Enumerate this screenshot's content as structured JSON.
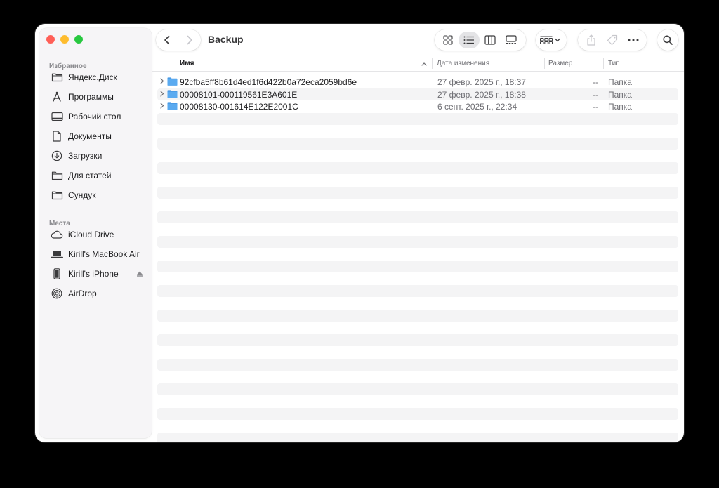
{
  "window": {
    "title": "Backup"
  },
  "sidebar": {
    "favorites_title": "Избранное",
    "favorites": [
      {
        "label": "Яндекс.Диск",
        "icon": "folder-icon"
      },
      {
        "label": "Программы",
        "icon": "applications-icon"
      },
      {
        "label": "Рабочий стол",
        "icon": "desktop-icon"
      },
      {
        "label": "Документы",
        "icon": "document-icon"
      },
      {
        "label": "Загрузки",
        "icon": "downloads-icon"
      },
      {
        "label": "Для статей",
        "icon": "folder-icon"
      },
      {
        "label": "Сундук",
        "icon": "folder-icon"
      }
    ],
    "locations_title": "Места",
    "locations": [
      {
        "label": "iCloud Drive",
        "icon": "cloud-icon"
      },
      {
        "label": "Kirill's MacBook Air",
        "icon": "laptop-icon"
      },
      {
        "label": "Kirill's iPhone",
        "icon": "iphone-icon"
      },
      {
        "label": "AirDrop",
        "icon": "airdrop-icon"
      }
    ]
  },
  "columns": {
    "name": "Имя",
    "date": "Дата изменения",
    "size": "Размер",
    "kind": "Тип"
  },
  "files": [
    {
      "name": "92cfba5ff8b61d4ed1f6d422b0a72eca2059bd6e",
      "date": "27 февр. 2025 г., 18:37",
      "size": "--",
      "kind": "Папка"
    },
    {
      "name": "00008101-000119561E3A601E",
      "date": "27 февр. 2025 г., 18:38",
      "size": "--",
      "kind": "Папка"
    },
    {
      "name": "00008130-001614E122E2001C",
      "date": "6 сент. 2025 г., 22:34",
      "size": "--",
      "kind": "Папка"
    }
  ],
  "colors": {
    "folder": "#5aaaf0",
    "folder_tab": "#4a9be6",
    "icon_stroke": "#3a3a3c"
  }
}
